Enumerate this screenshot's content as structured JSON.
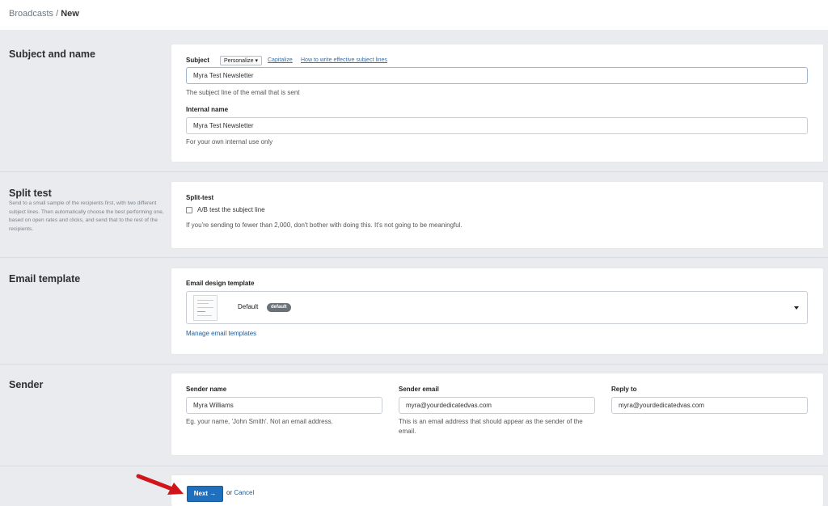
{
  "breadcrumb": {
    "parent": "Broadcasts",
    "separator": " / ",
    "current": "New"
  },
  "sections": {
    "subject": {
      "title": "Subject and name",
      "subject_label": "Subject",
      "personalize_label": "Personalize",
      "capitalize_link": "Capitalize",
      "howto_link": "How to write effective subject lines",
      "subject_value": "Myra Test Newsletter",
      "subject_help": "The subject line of the email that is sent",
      "internal_label": "Internal name",
      "internal_value": "Myra Test Newsletter",
      "internal_help": "For your own internal use only"
    },
    "split": {
      "title": "Split test",
      "description": "Send to a small sample of the recipients first, with two different subject lines. Then automatically choose the best performing one, based on open rates and clicks, and send that to the rest of the recipients.",
      "label": "Split-test",
      "checkbox_label": "A/B test the subject line",
      "checkbox_checked": false,
      "help": "If you're sending to fewer than 2,000, don't bother with doing this. It's not going to be meaningful."
    },
    "template": {
      "title": "Email template",
      "label": "Email design template",
      "selected": "Default",
      "badge": "default",
      "manage_link": "Manage email templates"
    },
    "sender": {
      "title": "Sender",
      "name_label": "Sender name",
      "name_value": "Myra Williams",
      "name_help": "Eg. your name, 'John Smith'. Not an email address.",
      "email_label": "Sender email",
      "email_value": "myra@yourdedicatedvas.com",
      "email_help": "This is an email address that should appear as the sender of the email.",
      "reply_label": "Reply to",
      "reply_value": "myra@yourdedicatedvas.com"
    }
  },
  "actions": {
    "next_label": "Next →",
    "or_text": "or",
    "cancel_label": "Cancel"
  },
  "colors": {
    "primary": "#1f6fbf",
    "link": "#1f5c9c",
    "arrow": "#d0161b",
    "background": "#e9ebee"
  }
}
